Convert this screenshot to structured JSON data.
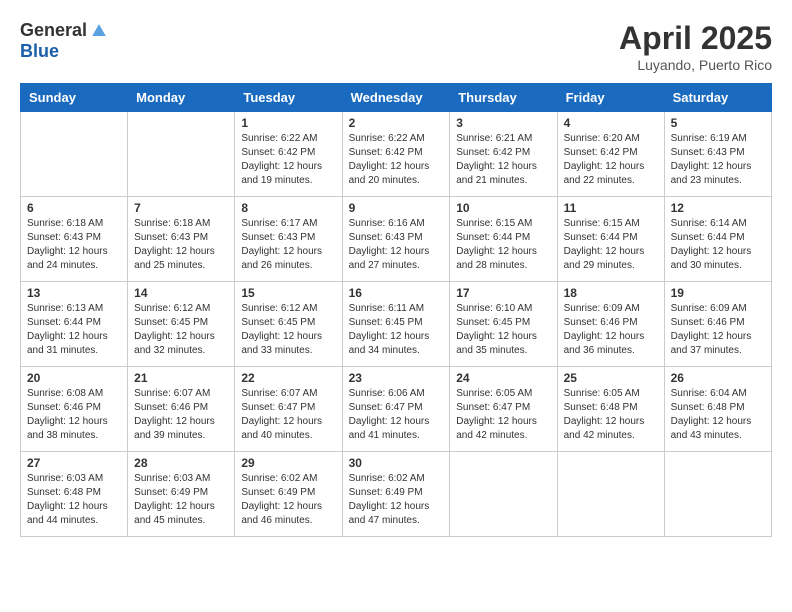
{
  "logo": {
    "general": "General",
    "blue": "Blue"
  },
  "title": "April 2025",
  "subtitle": "Luyando, Puerto Rico",
  "days_of_week": [
    "Sunday",
    "Monday",
    "Tuesday",
    "Wednesday",
    "Thursday",
    "Friday",
    "Saturday"
  ],
  "weeks": [
    [
      {
        "day": "",
        "info": ""
      },
      {
        "day": "",
        "info": ""
      },
      {
        "day": "1",
        "info": "Sunrise: 6:22 AM\nSunset: 6:42 PM\nDaylight: 12 hours and 19 minutes."
      },
      {
        "day": "2",
        "info": "Sunrise: 6:22 AM\nSunset: 6:42 PM\nDaylight: 12 hours and 20 minutes."
      },
      {
        "day": "3",
        "info": "Sunrise: 6:21 AM\nSunset: 6:42 PM\nDaylight: 12 hours and 21 minutes."
      },
      {
        "day": "4",
        "info": "Sunrise: 6:20 AM\nSunset: 6:42 PM\nDaylight: 12 hours and 22 minutes."
      },
      {
        "day": "5",
        "info": "Sunrise: 6:19 AM\nSunset: 6:43 PM\nDaylight: 12 hours and 23 minutes."
      }
    ],
    [
      {
        "day": "6",
        "info": "Sunrise: 6:18 AM\nSunset: 6:43 PM\nDaylight: 12 hours and 24 minutes."
      },
      {
        "day": "7",
        "info": "Sunrise: 6:18 AM\nSunset: 6:43 PM\nDaylight: 12 hours and 25 minutes."
      },
      {
        "day": "8",
        "info": "Sunrise: 6:17 AM\nSunset: 6:43 PM\nDaylight: 12 hours and 26 minutes."
      },
      {
        "day": "9",
        "info": "Sunrise: 6:16 AM\nSunset: 6:43 PM\nDaylight: 12 hours and 27 minutes."
      },
      {
        "day": "10",
        "info": "Sunrise: 6:15 AM\nSunset: 6:44 PM\nDaylight: 12 hours and 28 minutes."
      },
      {
        "day": "11",
        "info": "Sunrise: 6:15 AM\nSunset: 6:44 PM\nDaylight: 12 hours and 29 minutes."
      },
      {
        "day": "12",
        "info": "Sunrise: 6:14 AM\nSunset: 6:44 PM\nDaylight: 12 hours and 30 minutes."
      }
    ],
    [
      {
        "day": "13",
        "info": "Sunrise: 6:13 AM\nSunset: 6:44 PM\nDaylight: 12 hours and 31 minutes."
      },
      {
        "day": "14",
        "info": "Sunrise: 6:12 AM\nSunset: 6:45 PM\nDaylight: 12 hours and 32 minutes."
      },
      {
        "day": "15",
        "info": "Sunrise: 6:12 AM\nSunset: 6:45 PM\nDaylight: 12 hours and 33 minutes."
      },
      {
        "day": "16",
        "info": "Sunrise: 6:11 AM\nSunset: 6:45 PM\nDaylight: 12 hours and 34 minutes."
      },
      {
        "day": "17",
        "info": "Sunrise: 6:10 AM\nSunset: 6:45 PM\nDaylight: 12 hours and 35 minutes."
      },
      {
        "day": "18",
        "info": "Sunrise: 6:09 AM\nSunset: 6:46 PM\nDaylight: 12 hours and 36 minutes."
      },
      {
        "day": "19",
        "info": "Sunrise: 6:09 AM\nSunset: 6:46 PM\nDaylight: 12 hours and 37 minutes."
      }
    ],
    [
      {
        "day": "20",
        "info": "Sunrise: 6:08 AM\nSunset: 6:46 PM\nDaylight: 12 hours and 38 minutes."
      },
      {
        "day": "21",
        "info": "Sunrise: 6:07 AM\nSunset: 6:46 PM\nDaylight: 12 hours and 39 minutes."
      },
      {
        "day": "22",
        "info": "Sunrise: 6:07 AM\nSunset: 6:47 PM\nDaylight: 12 hours and 40 minutes."
      },
      {
        "day": "23",
        "info": "Sunrise: 6:06 AM\nSunset: 6:47 PM\nDaylight: 12 hours and 41 minutes."
      },
      {
        "day": "24",
        "info": "Sunrise: 6:05 AM\nSunset: 6:47 PM\nDaylight: 12 hours and 42 minutes."
      },
      {
        "day": "25",
        "info": "Sunrise: 6:05 AM\nSunset: 6:48 PM\nDaylight: 12 hours and 42 minutes."
      },
      {
        "day": "26",
        "info": "Sunrise: 6:04 AM\nSunset: 6:48 PM\nDaylight: 12 hours and 43 minutes."
      }
    ],
    [
      {
        "day": "27",
        "info": "Sunrise: 6:03 AM\nSunset: 6:48 PM\nDaylight: 12 hours and 44 minutes."
      },
      {
        "day": "28",
        "info": "Sunrise: 6:03 AM\nSunset: 6:49 PM\nDaylight: 12 hours and 45 minutes."
      },
      {
        "day": "29",
        "info": "Sunrise: 6:02 AM\nSunset: 6:49 PM\nDaylight: 12 hours and 46 minutes."
      },
      {
        "day": "30",
        "info": "Sunrise: 6:02 AM\nSunset: 6:49 PM\nDaylight: 12 hours and 47 minutes."
      },
      {
        "day": "",
        "info": ""
      },
      {
        "day": "",
        "info": ""
      },
      {
        "day": "",
        "info": ""
      }
    ]
  ]
}
